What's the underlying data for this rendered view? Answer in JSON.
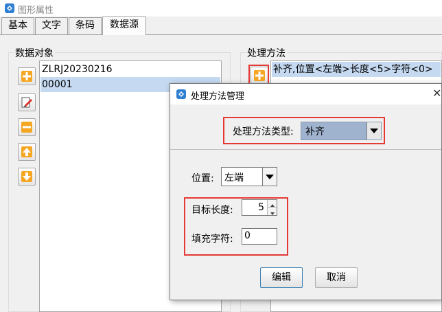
{
  "window": {
    "title": "图形属性"
  },
  "tabs": [
    {
      "label": "基本",
      "active": false
    },
    {
      "label": "文字",
      "active": false
    },
    {
      "label": "条码",
      "active": false
    },
    {
      "label": "数据源",
      "active": true
    }
  ],
  "data_objects": {
    "label": "数据对象",
    "items": [
      {
        "text": "ZLRJ20230216",
        "selected": false
      },
      {
        "text": "00001",
        "selected": true
      }
    ],
    "buttons": [
      "add",
      "edit",
      "remove",
      "move-up",
      "move-down"
    ]
  },
  "processing": {
    "label": "处理方法",
    "items": [
      {
        "text": "补齐,位置<左端>长度<5>字符<0>",
        "selected": true
      }
    ]
  },
  "dialog": {
    "title": "处理方法管理",
    "type_label": "处理方法类型:",
    "type_value": "补齐",
    "position_label": "位置:",
    "position_value": "左端",
    "length_label": "目标长度:",
    "length_value": "5",
    "fill_label": "填充字符:",
    "fill_value": "0",
    "edit_button": "编辑",
    "cancel_button": "取消"
  },
  "colors": {
    "selection": "#c5d9f1",
    "highlight_red": "#e53935",
    "icon_orange": "#f5a623"
  }
}
